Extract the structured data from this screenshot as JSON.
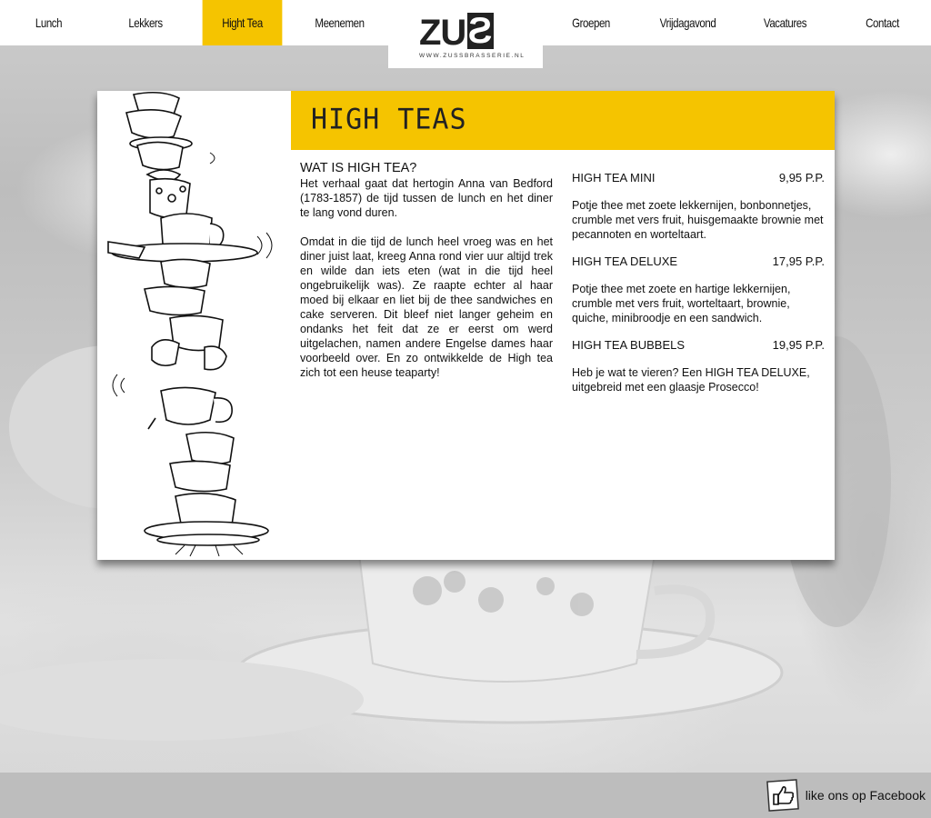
{
  "nav": {
    "items": [
      {
        "label": "Lunch",
        "active": false
      },
      {
        "label": "Lekkers",
        "active": false
      },
      {
        "label": "Hight Tea",
        "active": true
      },
      {
        "label": "Meenemen",
        "active": false
      },
      {
        "label": "Groepen",
        "active": false
      },
      {
        "label": "Vrijdagavond",
        "active": false
      },
      {
        "label": "Vacatures",
        "active": false
      },
      {
        "label": "Contact",
        "active": false
      }
    ],
    "logo": {
      "word": "ZU",
      "mark": "S",
      "url": "WWW.ZUSSBRASSERIE.NL"
    }
  },
  "banner": {
    "title": "HIGH TEAS"
  },
  "intro": {
    "heading": "WAT IS HIGH TEA?",
    "paragraphs": [
      "Het verhaal gaat dat hertogin Anna van Bedford (1783-1857) de tijd tussen de lunch en het diner te lang vond duren.",
      "Omdat in die tijd de lunch heel vroeg was en het diner juist laat, kreeg Anna rond vier uur altijd trek en wilde dan iets eten (wat in die tijd heel ongebruikelijk was). Ze raapte echter al haar moed bij elkaar en liet bij de thee sandwiches en cake serveren. Dit bleef niet langer geheim en ondanks het feit dat ze er eerst om werd uitgelachen, namen andere Engelse dames haar voorbeeld over. En zo ontwikkelde de High tea zich tot een heuse teaparty!"
    ]
  },
  "menu": [
    {
      "name": "HIGH TEA MINI",
      "price": "9,95 P.P.",
      "description": "Potje thee met zoete lekkernijen, bonbonnetjes, crumble met vers fruit, huisgemaakte brownie met pecannoten en worteltaart."
    },
    {
      "name": "HIGH TEA DELUXE",
      "price": "17,95 P.P.",
      "description": "Potje thee met zoete en hartige lekkernijen, crumble met vers fruit, worteltaart, brownie, quiche, minibroodje en een sandwich."
    },
    {
      "name": "HIGH TEA BUBBELS",
      "price": "19,95 P.P.",
      "description": "Heb je wat te vieren? Een HIGH TEA DELUXE, uitgebreid met een glaasje Prosecco!"
    }
  ],
  "footer": {
    "facebook_label": "like ons op Facebook",
    "facebook_icon": "thumbs-up-icon"
  },
  "colors": {
    "accent": "#f5c400",
    "nav_bg": "#ffffff",
    "footer_bg": "#bdbdbd"
  }
}
